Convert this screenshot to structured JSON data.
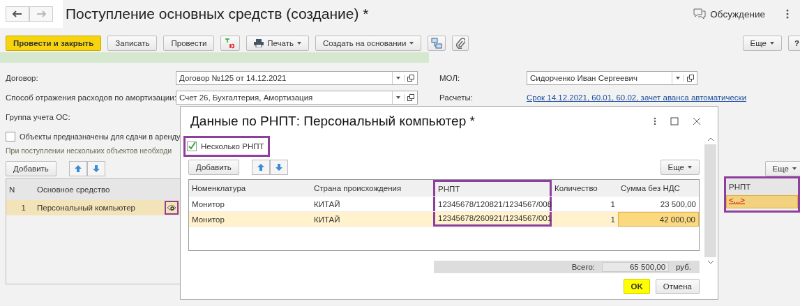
{
  "window": {
    "title": "Поступление основных средств (создание) *",
    "discussion": "Обсуждение"
  },
  "toolbar": {
    "buttons": [
      {
        "label": "Провести и закрыть",
        "kind": "primary"
      },
      {
        "label": "Записать",
        "kind": "plain"
      },
      {
        "label": "Провести",
        "kind": "plain"
      },
      {
        "kind": "dtkt"
      },
      {
        "label": "Печать",
        "kind": "menu"
      },
      {
        "label": "Создать на основании",
        "kind": "menu"
      },
      {
        "kind": "structure"
      },
      {
        "kind": "clip"
      }
    ],
    "more": "Еще",
    "help": "?"
  },
  "form": {
    "left": [
      {
        "label": "Договор:",
        "value": "Договор №125 от 14.12.2021"
      },
      {
        "label": "Способ отражения расходов по амортизации:",
        "value": "Счет 26, Бухгалтерия, Амортизация"
      },
      {
        "label": "Группа учета ОС:"
      }
    ],
    "right": [
      {
        "label": "МОЛ:",
        "value": "Сидорченко Иван Сергеевич",
        "kind": "field"
      },
      {
        "label": "Расчеты:",
        "value": "Срок 14.12.2021, 60.01, 60.02, зачет аванса автоматически",
        "kind": "link"
      }
    ],
    "lease_checkbox": {
      "label": "Объекты предназначены для сдачи в аренду",
      "checked": false
    },
    "hint": "При поступлении нескольких объектов необходи"
  },
  "assets": {
    "add": "Добавить",
    "columns": [
      "N",
      "Основное средство"
    ],
    "rows": [
      {
        "n": "1",
        "name": "Персональный компьютер",
        "selected": true,
        "highlighted": true
      }
    ],
    "more": "Еще",
    "rnpt_column": "РНПТ",
    "rnpt_cell": "<...>",
    "rnpt_highlighted": true
  },
  "dialog": {
    "title": "Данные по РНПТ: Персональный компьютер *",
    "multiple": {
      "label": "Несколько РНПТ",
      "checked": true,
      "highlighted": true
    },
    "add": "Добавить",
    "more": "Еще",
    "columns": [
      {
        "label": "Номенклатура",
        "highlighted": false
      },
      {
        "label": "Страна происхождения",
        "highlighted": false
      },
      {
        "label": "РНПТ",
        "highlighted": true
      },
      {
        "label": "Количество",
        "highlighted": false
      },
      {
        "label": "Сумма без НДС",
        "highlighted": false
      }
    ],
    "rows": [
      {
        "cells": [
          "Монитор",
          "КИТАЙ",
          "12345678/120821/1234567/008",
          "1",
          "23 500,00"
        ],
        "selected": false
      },
      {
        "cells": [
          "Монитор",
          "КИТАЙ",
          "12345678/260921/1234567/001",
          "1",
          "42 000,00"
        ],
        "selected": true
      }
    ],
    "total_label": "Всего:",
    "total": "65 500,00",
    "currency": "руб.",
    "ok": "OK",
    "cancel": "Отмена"
  }
}
